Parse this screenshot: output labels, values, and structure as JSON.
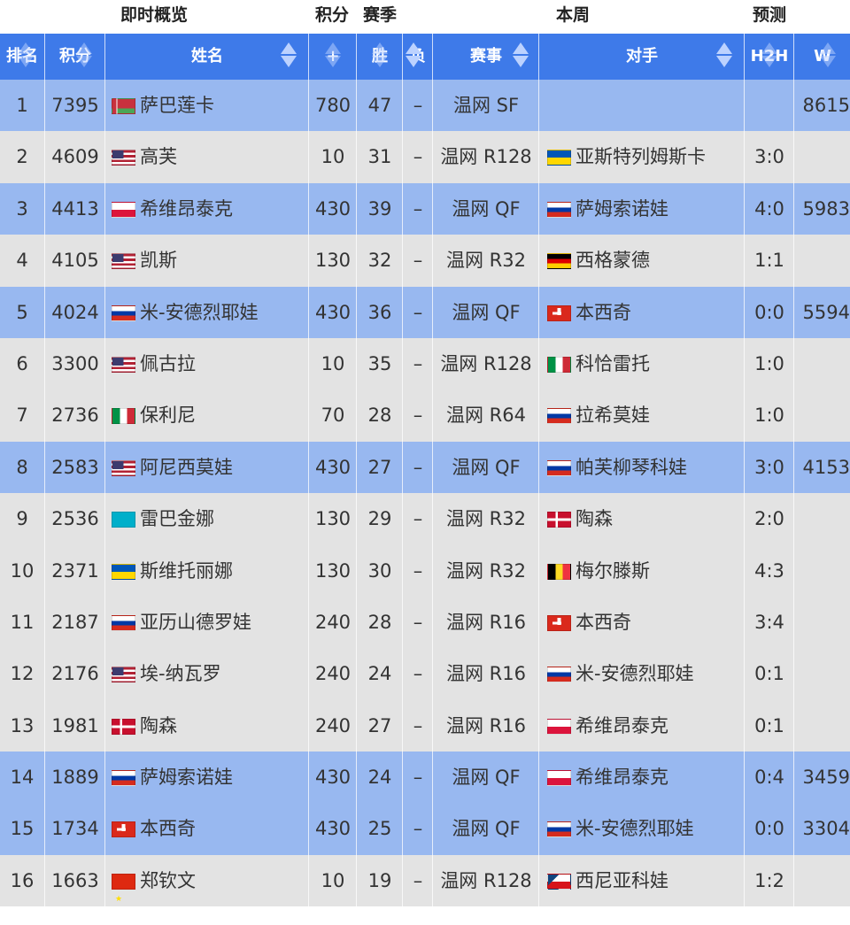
{
  "top_headers": {
    "overview": "即时概览",
    "points": "积分",
    "season": "赛季",
    "week": "本周",
    "predict": "预测"
  },
  "columns": {
    "rank": "排名",
    "pts": "积分",
    "name": "姓名",
    "plus": "+",
    "win": "胜",
    "loss": "负",
    "event": "赛事",
    "opponent": "对手",
    "h2h": "H2H",
    "w": "W"
  },
  "colors": {
    "header_blue": "#3e7ae9",
    "row_blue": "#98b8f0",
    "row_gray": "#e3e3e3"
  },
  "rows": [
    {
      "rank": "1",
      "pts": "7395",
      "flag": "by",
      "name": "萨巴莲卡",
      "plus": "780",
      "win": "47",
      "loss": "–",
      "event": "温网 SF",
      "opp_flag": "",
      "opp": "",
      "h2h": "",
      "w": "8615",
      "hl": true
    },
    {
      "rank": "2",
      "pts": "4609",
      "flag": "us",
      "name": "高芙",
      "plus": "10",
      "win": "31",
      "loss": "–",
      "event": "温网 R128",
      "opp_flag": "ua",
      "opp": "亚斯特列姆斯卡",
      "h2h": "3:0",
      "w": "",
      "hl": false
    },
    {
      "rank": "3",
      "pts": "4413",
      "flag": "pl",
      "name": "希维昂泰克",
      "plus": "430",
      "win": "39",
      "loss": "–",
      "event": "温网 QF",
      "opp_flag": "ru",
      "opp": "萨姆索诺娃",
      "h2h": "4:0",
      "w": "5983",
      "hl": true
    },
    {
      "rank": "4",
      "pts": "4105",
      "flag": "us",
      "name": "凯斯",
      "plus": "130",
      "win": "32",
      "loss": "–",
      "event": "温网 R32",
      "opp_flag": "de",
      "opp": "西格蒙德",
      "h2h": "1:1",
      "w": "",
      "hl": false
    },
    {
      "rank": "5",
      "pts": "4024",
      "flag": "ru",
      "name": "米-安德烈耶娃",
      "plus": "430",
      "win": "36",
      "loss": "–",
      "event": "温网 QF",
      "opp_flag": "ch",
      "opp": "本西奇",
      "h2h": "0:0",
      "w": "5594",
      "hl": true
    },
    {
      "rank": "6",
      "pts": "3300",
      "flag": "us",
      "name": "佩古拉",
      "plus": "10",
      "win": "35",
      "loss": "–",
      "event": "温网 R128",
      "opp_flag": "it",
      "opp": "科恰雷托",
      "h2h": "1:0",
      "w": "",
      "hl": false
    },
    {
      "rank": "7",
      "pts": "2736",
      "flag": "it",
      "name": "保利尼",
      "plus": "70",
      "win": "28",
      "loss": "–",
      "event": "温网 R64",
      "opp_flag": "ru",
      "opp": "拉希莫娃",
      "h2h": "1:0",
      "w": "",
      "hl": false
    },
    {
      "rank": "8",
      "pts": "2583",
      "flag": "us",
      "name": "阿尼西莫娃",
      "plus": "430",
      "win": "27",
      "loss": "–",
      "event": "温网 QF",
      "opp_flag": "ru",
      "opp": "帕芙柳琴科娃",
      "h2h": "3:0",
      "w": "4153",
      "hl": true
    },
    {
      "rank": "9",
      "pts": "2536",
      "flag": "kz",
      "name": "雷巴金娜",
      "plus": "130",
      "win": "29",
      "loss": "–",
      "event": "温网 R32",
      "opp_flag": "dk",
      "opp": "陶森",
      "h2h": "2:0",
      "w": "",
      "hl": false
    },
    {
      "rank": "10",
      "pts": "2371",
      "flag": "ua",
      "name": "斯维托丽娜",
      "plus": "130",
      "win": "30",
      "loss": "–",
      "event": "温网 R32",
      "opp_flag": "be",
      "opp": "梅尔滕斯",
      "h2h": "4:3",
      "w": "",
      "hl": false
    },
    {
      "rank": "11",
      "pts": "2187",
      "flag": "ru",
      "name": "亚历山德罗娃",
      "plus": "240",
      "win": "28",
      "loss": "–",
      "event": "温网 R16",
      "opp_flag": "ch",
      "opp": "本西奇",
      "h2h": "3:4",
      "w": "",
      "hl": false
    },
    {
      "rank": "12",
      "pts": "2176",
      "flag": "us",
      "name": "埃-纳瓦罗",
      "plus": "240",
      "win": "24",
      "loss": "–",
      "event": "温网 R16",
      "opp_flag": "ru",
      "opp": "米-安德烈耶娃",
      "h2h": "0:1",
      "w": "",
      "hl": false
    },
    {
      "rank": "13",
      "pts": "1981",
      "flag": "dk",
      "name": "陶森",
      "plus": "240",
      "win": "27",
      "loss": "–",
      "event": "温网 R16",
      "opp_flag": "pl",
      "opp": "希维昂泰克",
      "h2h": "0:1",
      "w": "",
      "hl": false
    },
    {
      "rank": "14",
      "pts": "1889",
      "flag": "ru",
      "name": "萨姆索诺娃",
      "plus": "430",
      "win": "24",
      "loss": "–",
      "event": "温网 QF",
      "opp_flag": "pl",
      "opp": "希维昂泰克",
      "h2h": "0:4",
      "w": "3459",
      "hl": true
    },
    {
      "rank": "15",
      "pts": "1734",
      "flag": "ch",
      "name": "本西奇",
      "plus": "430",
      "win": "25",
      "loss": "–",
      "event": "温网 QF",
      "opp_flag": "ru",
      "opp": "米-安德烈耶娃",
      "h2h": "0:0",
      "w": "3304",
      "hl": true
    },
    {
      "rank": "16",
      "pts": "1663",
      "flag": "cn",
      "name": "郑钦文",
      "plus": "10",
      "win": "19",
      "loss": "–",
      "event": "温网 R128",
      "opp_flag": "cz",
      "opp": "西尼亚科娃",
      "h2h": "1:2",
      "w": "",
      "hl": false
    }
  ]
}
